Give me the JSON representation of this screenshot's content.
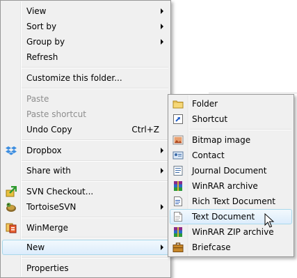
{
  "context_menu": {
    "items": [
      {
        "label": "View",
        "submenu": true
      },
      {
        "label": "Sort by",
        "submenu": true
      },
      {
        "label": "Group by",
        "submenu": true
      },
      {
        "label": "Refresh"
      },
      {
        "label": "Customize this folder..."
      },
      {
        "label": "Paste",
        "disabled": true
      },
      {
        "label": "Paste shortcut",
        "disabled": true
      },
      {
        "label": "Undo Copy",
        "shortcut": "Ctrl+Z"
      },
      {
        "label": "Dropbox",
        "icon": "dropbox-icon",
        "submenu": true
      },
      {
        "label": "Share with",
        "submenu": true
      },
      {
        "label": "SVN Checkout...",
        "icon": "svn-checkout-icon"
      },
      {
        "label": "TortoiseSVN",
        "icon": "tortoisesvn-icon",
        "submenu": true
      },
      {
        "label": "WinMerge",
        "icon": "winmerge-icon"
      },
      {
        "label": "New",
        "submenu": true,
        "highlighted": true
      },
      {
        "label": "Properties"
      }
    ]
  },
  "new_submenu": {
    "items": [
      {
        "label": "Folder",
        "icon": "folder-icon"
      },
      {
        "label": "Shortcut",
        "icon": "shortcut-icon"
      },
      {
        "label": "Bitmap image",
        "icon": "bitmap-icon"
      },
      {
        "label": "Contact",
        "icon": "contact-icon"
      },
      {
        "label": "Journal Document",
        "icon": "journal-icon"
      },
      {
        "label": "WinRAR archive",
        "icon": "winrar-icon"
      },
      {
        "label": "Rich Text Document",
        "icon": "rtf-icon"
      },
      {
        "label": "Text Document",
        "icon": "text-document-icon",
        "highlighted": true
      },
      {
        "label": "WinRAR ZIP archive",
        "icon": "winrar-zip-icon"
      },
      {
        "label": "Briefcase",
        "icon": "briefcase-icon"
      }
    ]
  },
  "colors": {
    "menu_bg": "#f0f0f0",
    "menu_border": "#979797",
    "highlight_border": "#a8d8eb",
    "highlight_fill": "#dcecfc",
    "disabled_text": "#8d8d8d"
  }
}
